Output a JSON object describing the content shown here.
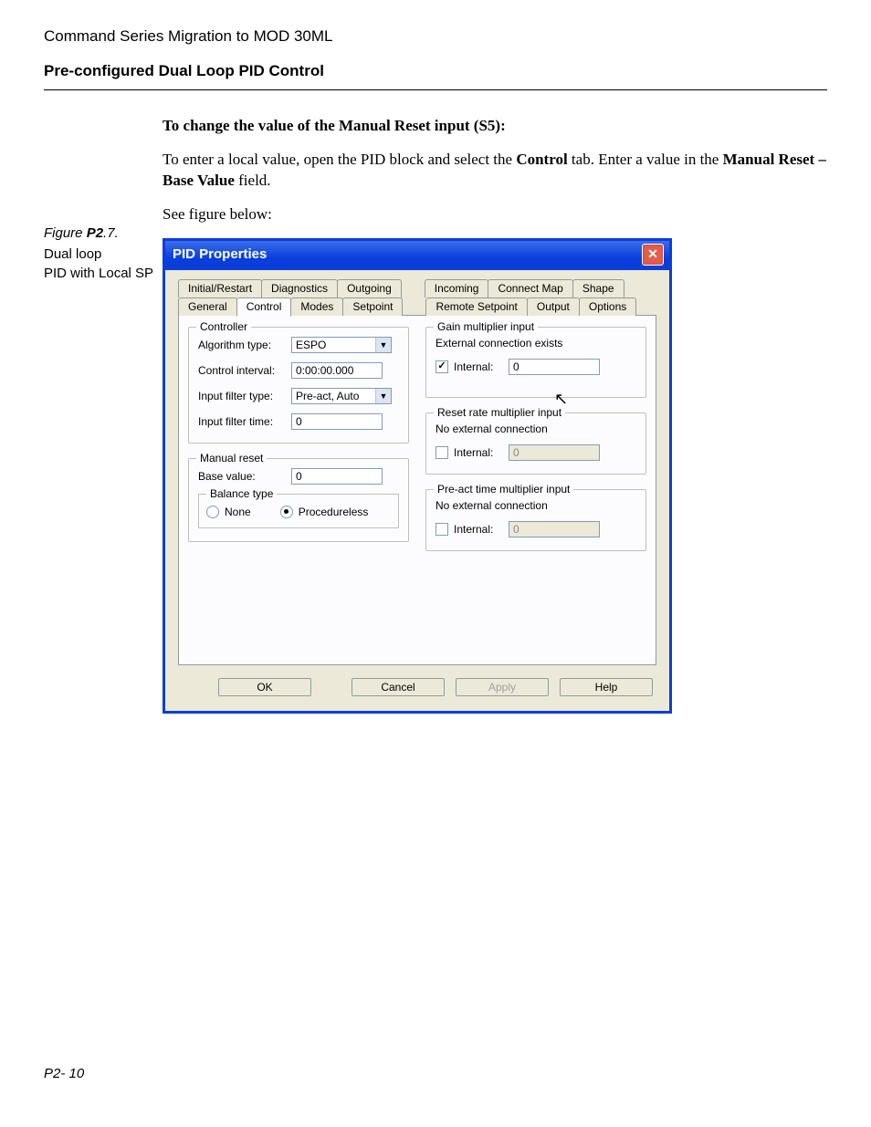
{
  "doc": {
    "header_small": "Command Series Migration to MOD 30ML",
    "header_bold": "Pre-configured Dual Loop PID Control",
    "heading_strong": "To change the value of the Manual Reset input (S5):",
    "para1_prefix": "To enter a local value, open the PID block and select the ",
    "para1_bold1": "Control",
    "para1_mid": " tab. Enter a value in the ",
    "para1_bold2": "Manual Reset – Base Value",
    "para1_suffix": " field.",
    "para2": "See figure below:",
    "figure_label_pre": "Figure ",
    "figure_label_bold": "P2",
    "figure_label_post": ".7.",
    "figure_caption1": "Dual loop",
    "figure_caption2": "PID with Local SP",
    "page_footer": "P2- 10"
  },
  "dialog": {
    "title": "PID Properties",
    "tabs_row1": [
      "Initial/Restart",
      "Diagnostics",
      "Outgoing",
      "Incoming",
      "Connect Map",
      "Shape"
    ],
    "tabs_row2": [
      "General",
      "Control",
      "Modes",
      "Setpoint",
      "Remote Setpoint",
      "Output",
      "Options"
    ],
    "active_tab": "Control",
    "controller": {
      "legend": "Controller",
      "algorithm_label": "Algorithm type:",
      "algorithm_value": "ESPO",
      "interval_label": "Control interval:",
      "interval_value": "0:00:00.000",
      "filter_type_label": "Input filter type:",
      "filter_type_value": "Pre-act, Auto",
      "filter_time_label": "Input filter time:",
      "filter_time_value": "0"
    },
    "manual_reset": {
      "legend": "Manual reset",
      "base_label": "Base value:",
      "base_value": "0",
      "balance_legend": "Balance type",
      "balance_none": "None",
      "balance_procedureless": "Procedureless"
    },
    "gain": {
      "legend": "Gain multiplier input",
      "status": "External connection exists",
      "internal_label": "Internal:",
      "internal_value": "0",
      "internal_checked": true
    },
    "reset_rate": {
      "legend": "Reset rate multiplier input",
      "status": "No external connection",
      "internal_label": "Internal:",
      "internal_value": "0",
      "internal_checked": false
    },
    "preact": {
      "legend": "Pre-act time multiplier input",
      "status": "No external connection",
      "internal_label": "Internal:",
      "internal_value": "0",
      "internal_checked": false
    },
    "buttons": {
      "ok": "OK",
      "cancel": "Cancel",
      "apply": "Apply",
      "help": "Help"
    }
  }
}
